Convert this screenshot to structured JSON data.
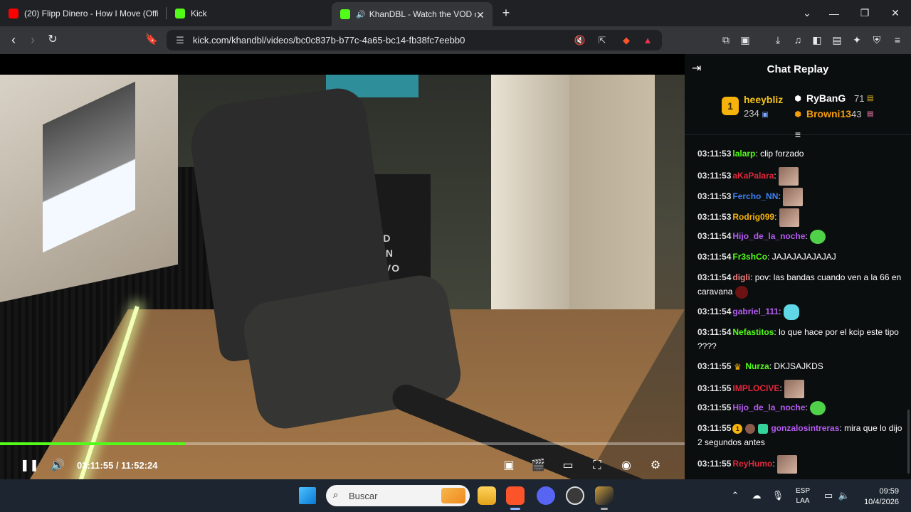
{
  "browser": {
    "tabs": [
      {
        "title": "(20) Flipp Dinero - How I Move (Offic",
        "favicon_color": "#ff0000",
        "active": false
      },
      {
        "title": "Kick",
        "favicon_color": "#53fc18",
        "active": false
      },
      {
        "title": "KhanDBL - Watch the VOD on",
        "favicon_color": "#53fc18",
        "active": true
      }
    ],
    "new_tab_label": "+",
    "url": "kick.com/khandbl/videos/bc0c837b-b77c-4a65-bc14-fb38fc7eebb0"
  },
  "video": {
    "progress_fraction": 0.27,
    "current_time": "03:11:55",
    "duration": "11:52:24",
    "time_separator": " / ",
    "bin_text": "HAND\nOIS IN\nALL VO\nRDAY"
  },
  "chat": {
    "title": "Chat Replay",
    "leaderboard": {
      "first": {
        "rank": "1",
        "name": "heeybliz",
        "count": "234"
      },
      "second": {
        "name": "RyBanG",
        "count": "71"
      },
      "third": {
        "name": "Browni13",
        "count": "43"
      }
    },
    "messages": [
      {
        "time": "03:11:53",
        "user": "lalarp",
        "color": "#53fc18",
        "text": "clip forzado",
        "emote": ""
      },
      {
        "time": "03:11:53",
        "user": "aKaPalara",
        "color": "#e3273b",
        "text": "",
        "emote": "emote"
      },
      {
        "time": "03:11:53",
        "user": "Fercho_NN",
        "color": "#3b82f6",
        "text": "",
        "emote": "emote"
      },
      {
        "time": "03:11:53",
        "user": "Rodrig099",
        "color": "#f5b30b",
        "text": "",
        "emote": "emote"
      },
      {
        "time": "03:11:54",
        "user": "Hijo_de_la_noche",
        "color": "#b55cf2",
        "text": "",
        "emote": "emote-green"
      },
      {
        "time": "03:11:54",
        "user": "Fr3shCo",
        "color": "#53fc18",
        "text": "JAJAJAJAJAJAJ",
        "emote": ""
      },
      {
        "time": "03:11:54",
        "user": "digli",
        "color": "#f27f7f",
        "text": "pov: las bandas cuando ven a la 66 en caravana",
        "emote": "emote-red"
      },
      {
        "time": "03:11:54",
        "user": "gabriel_111",
        "color": "#b55cf2",
        "text": "",
        "emote": "emote-blue"
      },
      {
        "time": "03:11:54",
        "user": "Nefastitos",
        "color": "#53fc18",
        "text": "lo que hace por el kcip este tipo ????",
        "emote": ""
      },
      {
        "time": "03:11:55",
        "user": "Nurza",
        "color": "#53fc18",
        "text": "DKJSAJKDS",
        "emote": ""
      },
      {
        "time": "03:11:55",
        "user": "IMPLOCIVE",
        "color": "#e3273b",
        "text": "",
        "emote": "emote"
      },
      {
        "time": "03:11:55",
        "user": "Hijo_de_la_noche",
        "color": "#b55cf2",
        "text": "",
        "emote": "emote-green"
      },
      {
        "time": "03:11:55",
        "user": "gonzalosintreras",
        "color": "#b55cf2",
        "text": "mira que lo dijo 2 segundos antes",
        "emote": ""
      },
      {
        "time": "03:11:55",
        "user": "ReyHumo",
        "color": "#e3273b",
        "text": "",
        "emote": "emote"
      }
    ]
  },
  "taskbar": {
    "search_placeholder": "Buscar",
    "lang_line1": "ESP",
    "lang_line2": "LAA",
    "time": "09:59",
    "date": "10/4/2026"
  }
}
